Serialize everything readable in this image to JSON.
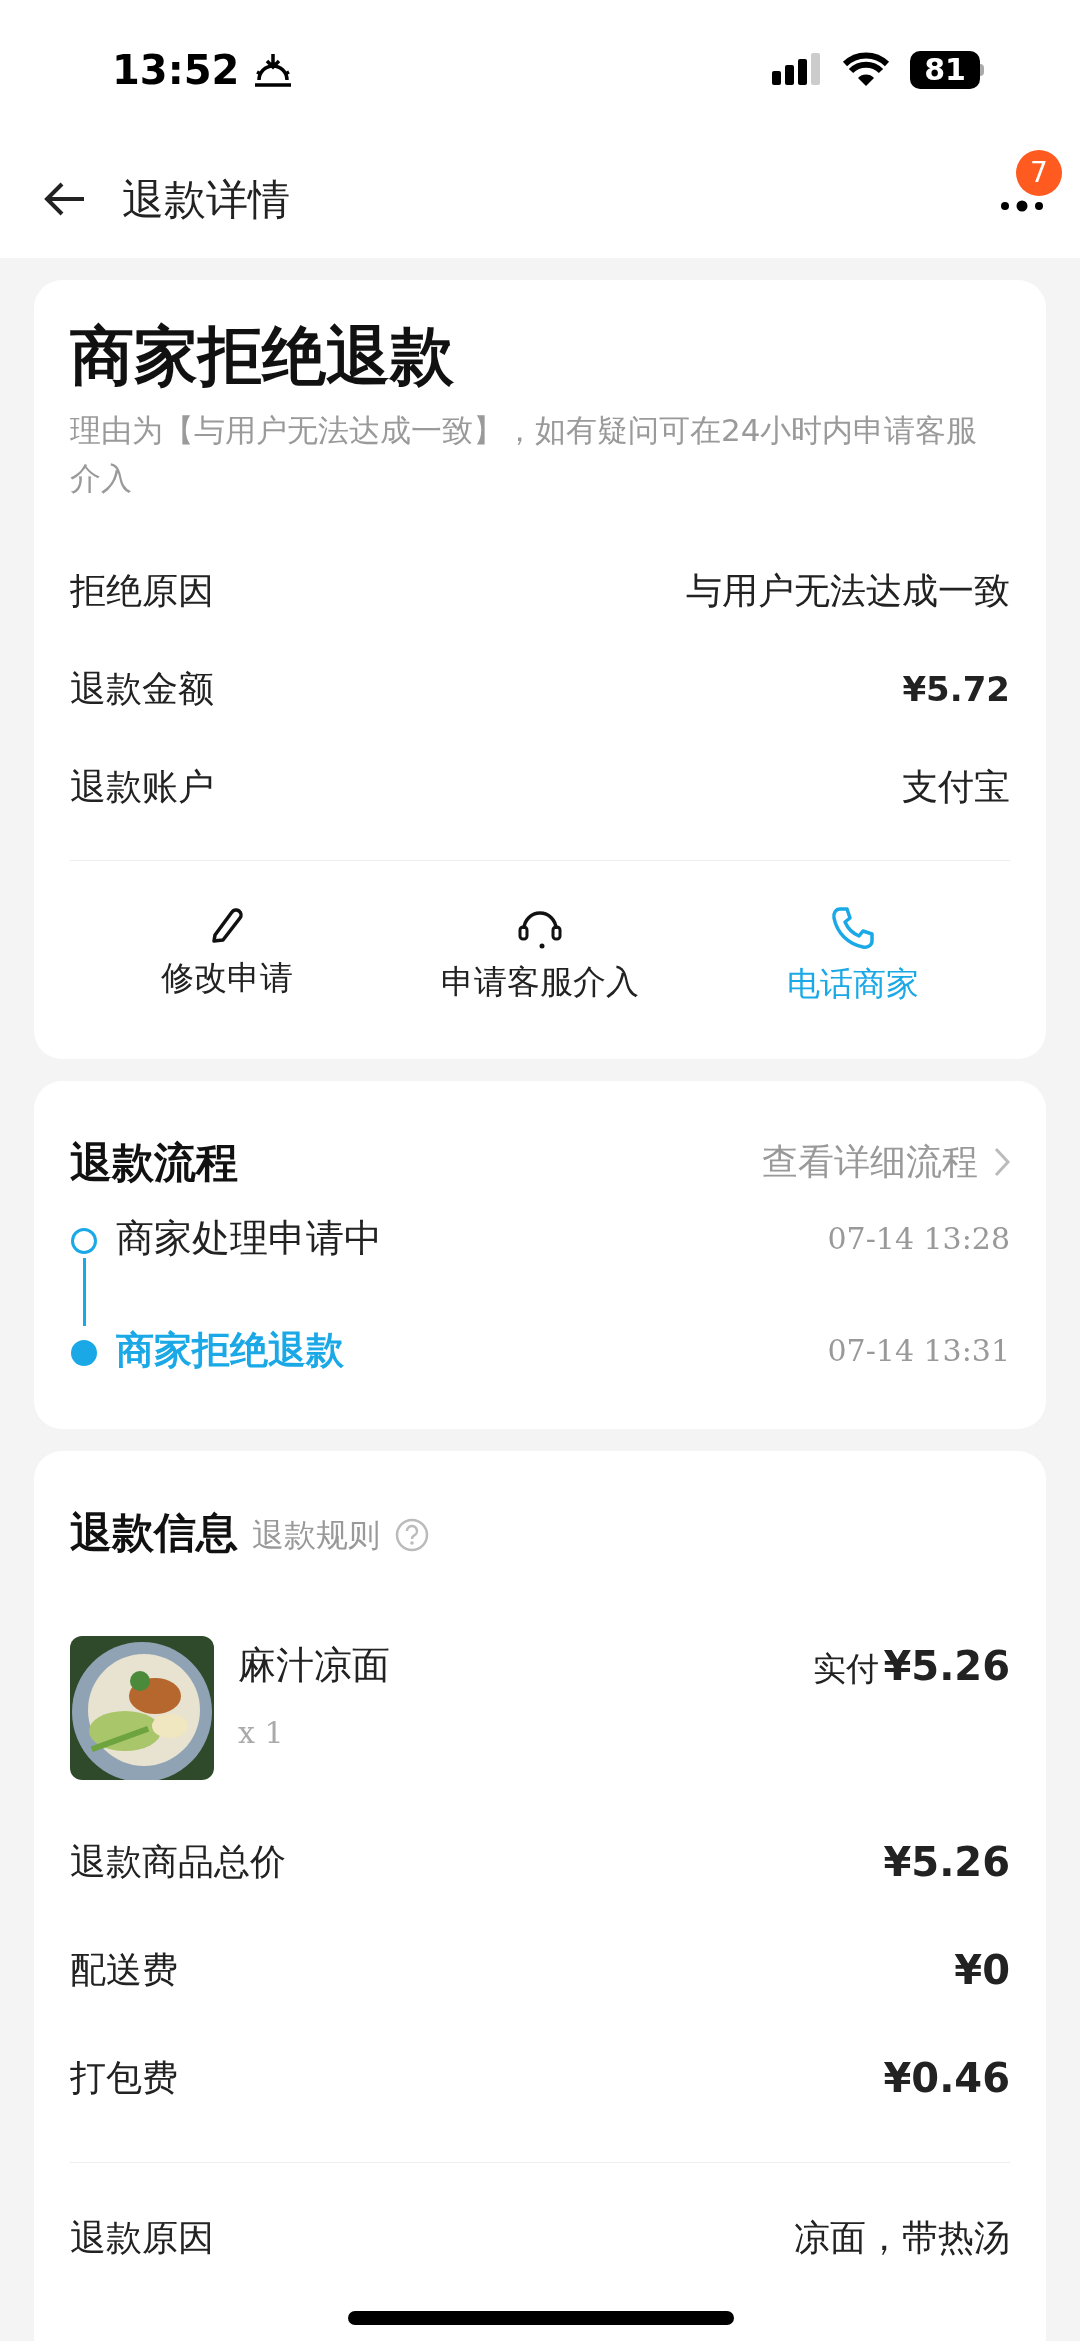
{
  "status_bar": {
    "time": "13:52",
    "battery": "81"
  },
  "nav": {
    "title": "退款详情",
    "badge": "7"
  },
  "summary": {
    "title": "商家拒绝退款",
    "note": "理由为【与用户无法达成一致】，如有疑问可在24小时内申请客服介入",
    "rows": [
      {
        "label": "拒绝原因",
        "value": "与用户无法达成一致",
        "kind": "text"
      },
      {
        "label": "退款金额",
        "value": "¥5.72",
        "kind": "price"
      },
      {
        "label": "退款账户",
        "value": "支付宝",
        "kind": "text"
      }
    ],
    "actions": [
      {
        "label": "修改申请",
        "kind": "edit",
        "highlighted": false
      },
      {
        "label": "申请客服介入",
        "kind": "headset",
        "highlighted": false
      },
      {
        "label": "电话商家",
        "kind": "phone",
        "highlighted": true
      }
    ]
  },
  "process": {
    "title": "退款流程",
    "link": "查看详细流程",
    "steps": [
      {
        "label": "商家处理申请中",
        "time": "07-14 13:28",
        "current": false
      },
      {
        "label": "商家拒绝退款",
        "time": "07-14 13:31",
        "current": true
      }
    ]
  },
  "info": {
    "title": "退款信息",
    "rules": "退款规则",
    "item": {
      "name": "麻汁凉面",
      "qty": "x 1",
      "paid_label": "实付",
      "paid": "¥5.26"
    },
    "fees": [
      {
        "label": "退款商品总价",
        "value": "¥5.26"
      },
      {
        "label": "配送费",
        "value": "¥0"
      },
      {
        "label": "打包费",
        "value": "¥0.46"
      }
    ],
    "reason": {
      "label": "退款原因",
      "value": "凉面，带热汤"
    }
  }
}
